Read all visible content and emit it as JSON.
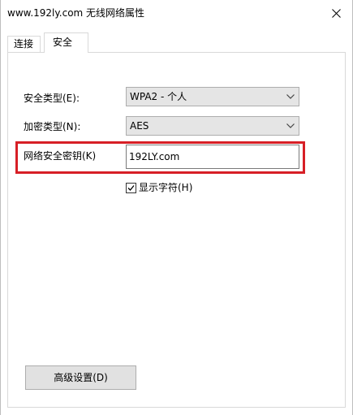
{
  "window": {
    "title": "www.192ly.com 无线网络属性"
  },
  "tabs": [
    {
      "label": "连接",
      "selected": false
    },
    {
      "label": "安全",
      "selected": true
    }
  ],
  "security": {
    "security_type_label": "安全类型(E):",
    "security_type_value": "WPA2 - 个人",
    "encryption_type_label": "加密类型(N):",
    "encryption_type_value": "AES",
    "network_key_label": "网络安全密钥(K)",
    "network_key_value": "192LY.com",
    "show_characters_label": "显示字符(H)",
    "show_characters_checked": true,
    "advanced_button_label": "高级设置(D)"
  },
  "colors": {
    "highlight_border": "#d71f26",
    "combo_background": "#e5e5e5",
    "button_background": "#e1e1e1"
  },
  "icons": {
    "close": "close-icon",
    "dropdown": "chevron-down-icon",
    "check": "checkmark-icon"
  }
}
